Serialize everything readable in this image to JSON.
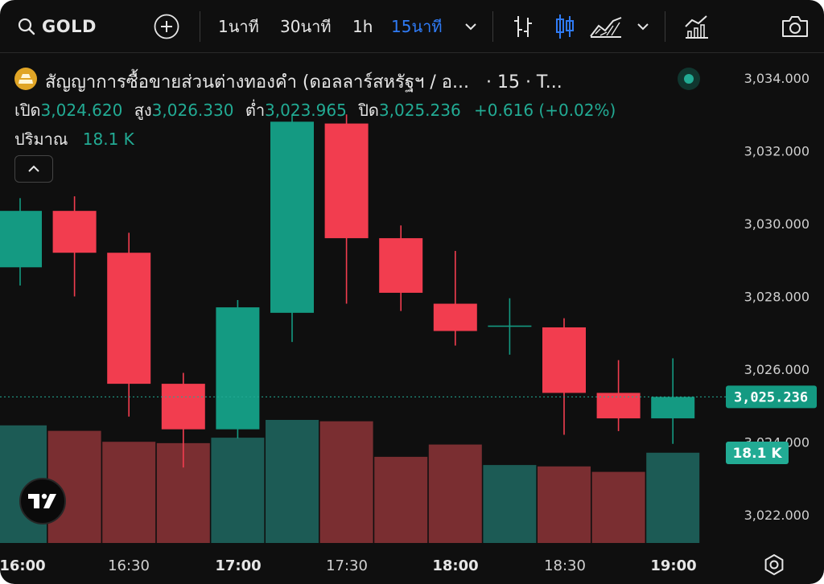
{
  "toolbar": {
    "symbol": "GOLD",
    "timeframes": [
      "1นาที",
      "30นาที",
      "1h",
      "15นาที"
    ],
    "active_timeframe": "15นาที"
  },
  "legend": {
    "title": "สัญญาการซื้อขายส่วนต่างทองคำ (ดอลลาร์สหรัฐฯ / อ...",
    "interval": "· 15 · T...",
    "open_label": "เปิด",
    "open": "3,024.620",
    "high_label": "สูง",
    "high": "3,026.330",
    "low_label": "ต่ำ",
    "low": "3,023.965",
    "close_label": "ปิด",
    "close": "3,025.236",
    "change": "+0.616 (+0.02%)",
    "volume_label": "ปริมาณ",
    "volume": "18.1 K"
  },
  "colors": {
    "up": "#149a82",
    "down": "#f23d4f",
    "vol_up": "#1c5b55",
    "vol_down": "#7a2e31",
    "axis_text": "#d0d0d0",
    "background": "#0f0f0f"
  },
  "chart_data": {
    "type": "candlestick",
    "y_axis_ticks": [
      "3,034.000",
      "3,032.000",
      "3,030.000",
      "3,028.000",
      "3,026.000",
      "3,024.000",
      "3,022.000"
    ],
    "x_axis_ticks": [
      "16:00",
      "16:30",
      "17:00",
      "17:30",
      "18:00",
      "18:30",
      "19:00"
    ],
    "ylim": [
      3021.3,
      3034.4
    ],
    "last_price_label": "3,025.236",
    "last_volume_label": "18.1 K",
    "candles": [
      {
        "o": 3028.8,
        "h": 3030.7,
        "l": 3028.3,
        "c": 3030.35
      },
      {
        "o": 3030.35,
        "h": 3030.75,
        "l": 3028.0,
        "c": 3029.2
      },
      {
        "o": 3029.2,
        "h": 3029.75,
        "l": 3024.7,
        "c": 3025.6
      },
      {
        "o": 3025.6,
        "h": 3025.9,
        "l": 3023.3,
        "c": 3024.35
      },
      {
        "o": 3024.35,
        "h": 3027.9,
        "l": 3024.1,
        "c": 3027.7
      },
      {
        "o": 3027.55,
        "h": 3033.0,
        "l": 3026.75,
        "c": 3032.8
      },
      {
        "o": 3032.75,
        "h": 3033.0,
        "l": 3027.8,
        "c": 3029.6
      },
      {
        "o": 3029.6,
        "h": 3029.95,
        "l": 3027.6,
        "c": 3028.1
      },
      {
        "o": 3027.8,
        "h": 3029.25,
        "l": 3026.65,
        "c": 3027.05
      },
      {
        "o": 3027.2,
        "h": 3027.95,
        "l": 3026.4,
        "c": 3027.2
      },
      {
        "o": 3027.15,
        "h": 3027.4,
        "l": 3024.2,
        "c": 3025.35
      },
      {
        "o": 3025.35,
        "h": 3026.25,
        "l": 3024.3,
        "c": 3024.65
      },
      {
        "o": 3024.65,
        "h": 3026.3,
        "l": 3023.95,
        "c": 3025.24
      }
    ],
    "volumes": [
      {
        "v": 0.86,
        "dir": "up"
      },
      {
        "v": 0.82,
        "dir": "down"
      },
      {
        "v": 0.74,
        "dir": "down"
      },
      {
        "v": 0.73,
        "dir": "down"
      },
      {
        "v": 0.77,
        "dir": "up"
      },
      {
        "v": 0.9,
        "dir": "up"
      },
      {
        "v": 0.89,
        "dir": "down"
      },
      {
        "v": 0.63,
        "dir": "down"
      },
      {
        "v": 0.72,
        "dir": "down"
      },
      {
        "v": 0.57,
        "dir": "up"
      },
      {
        "v": 0.56,
        "dir": "down"
      },
      {
        "v": 0.52,
        "dir": "down"
      },
      {
        "v": 0.66,
        "dir": "up"
      }
    ]
  }
}
